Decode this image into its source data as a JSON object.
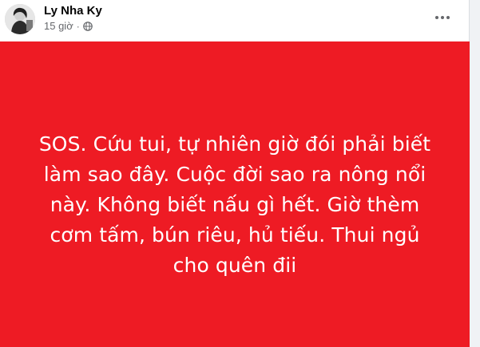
{
  "post": {
    "author": "Ly Nha Ky",
    "time": "15 giờ",
    "separator": "·",
    "privacy_icon": "globe-icon",
    "more_icon": "more-horizontal-icon",
    "body_text": "SOS. Cứu tui, tự nhiên giờ đói phải biết làm sao đây. Cuộc đời sao ra nông nổi này. Không biết nấu gì hết. Giờ thèm cơm tấm, bún riêu, hủ tiếu. Thui ngủ cho quên đii",
    "background_color": "#ee1b24",
    "text_color": "#ffffff"
  }
}
